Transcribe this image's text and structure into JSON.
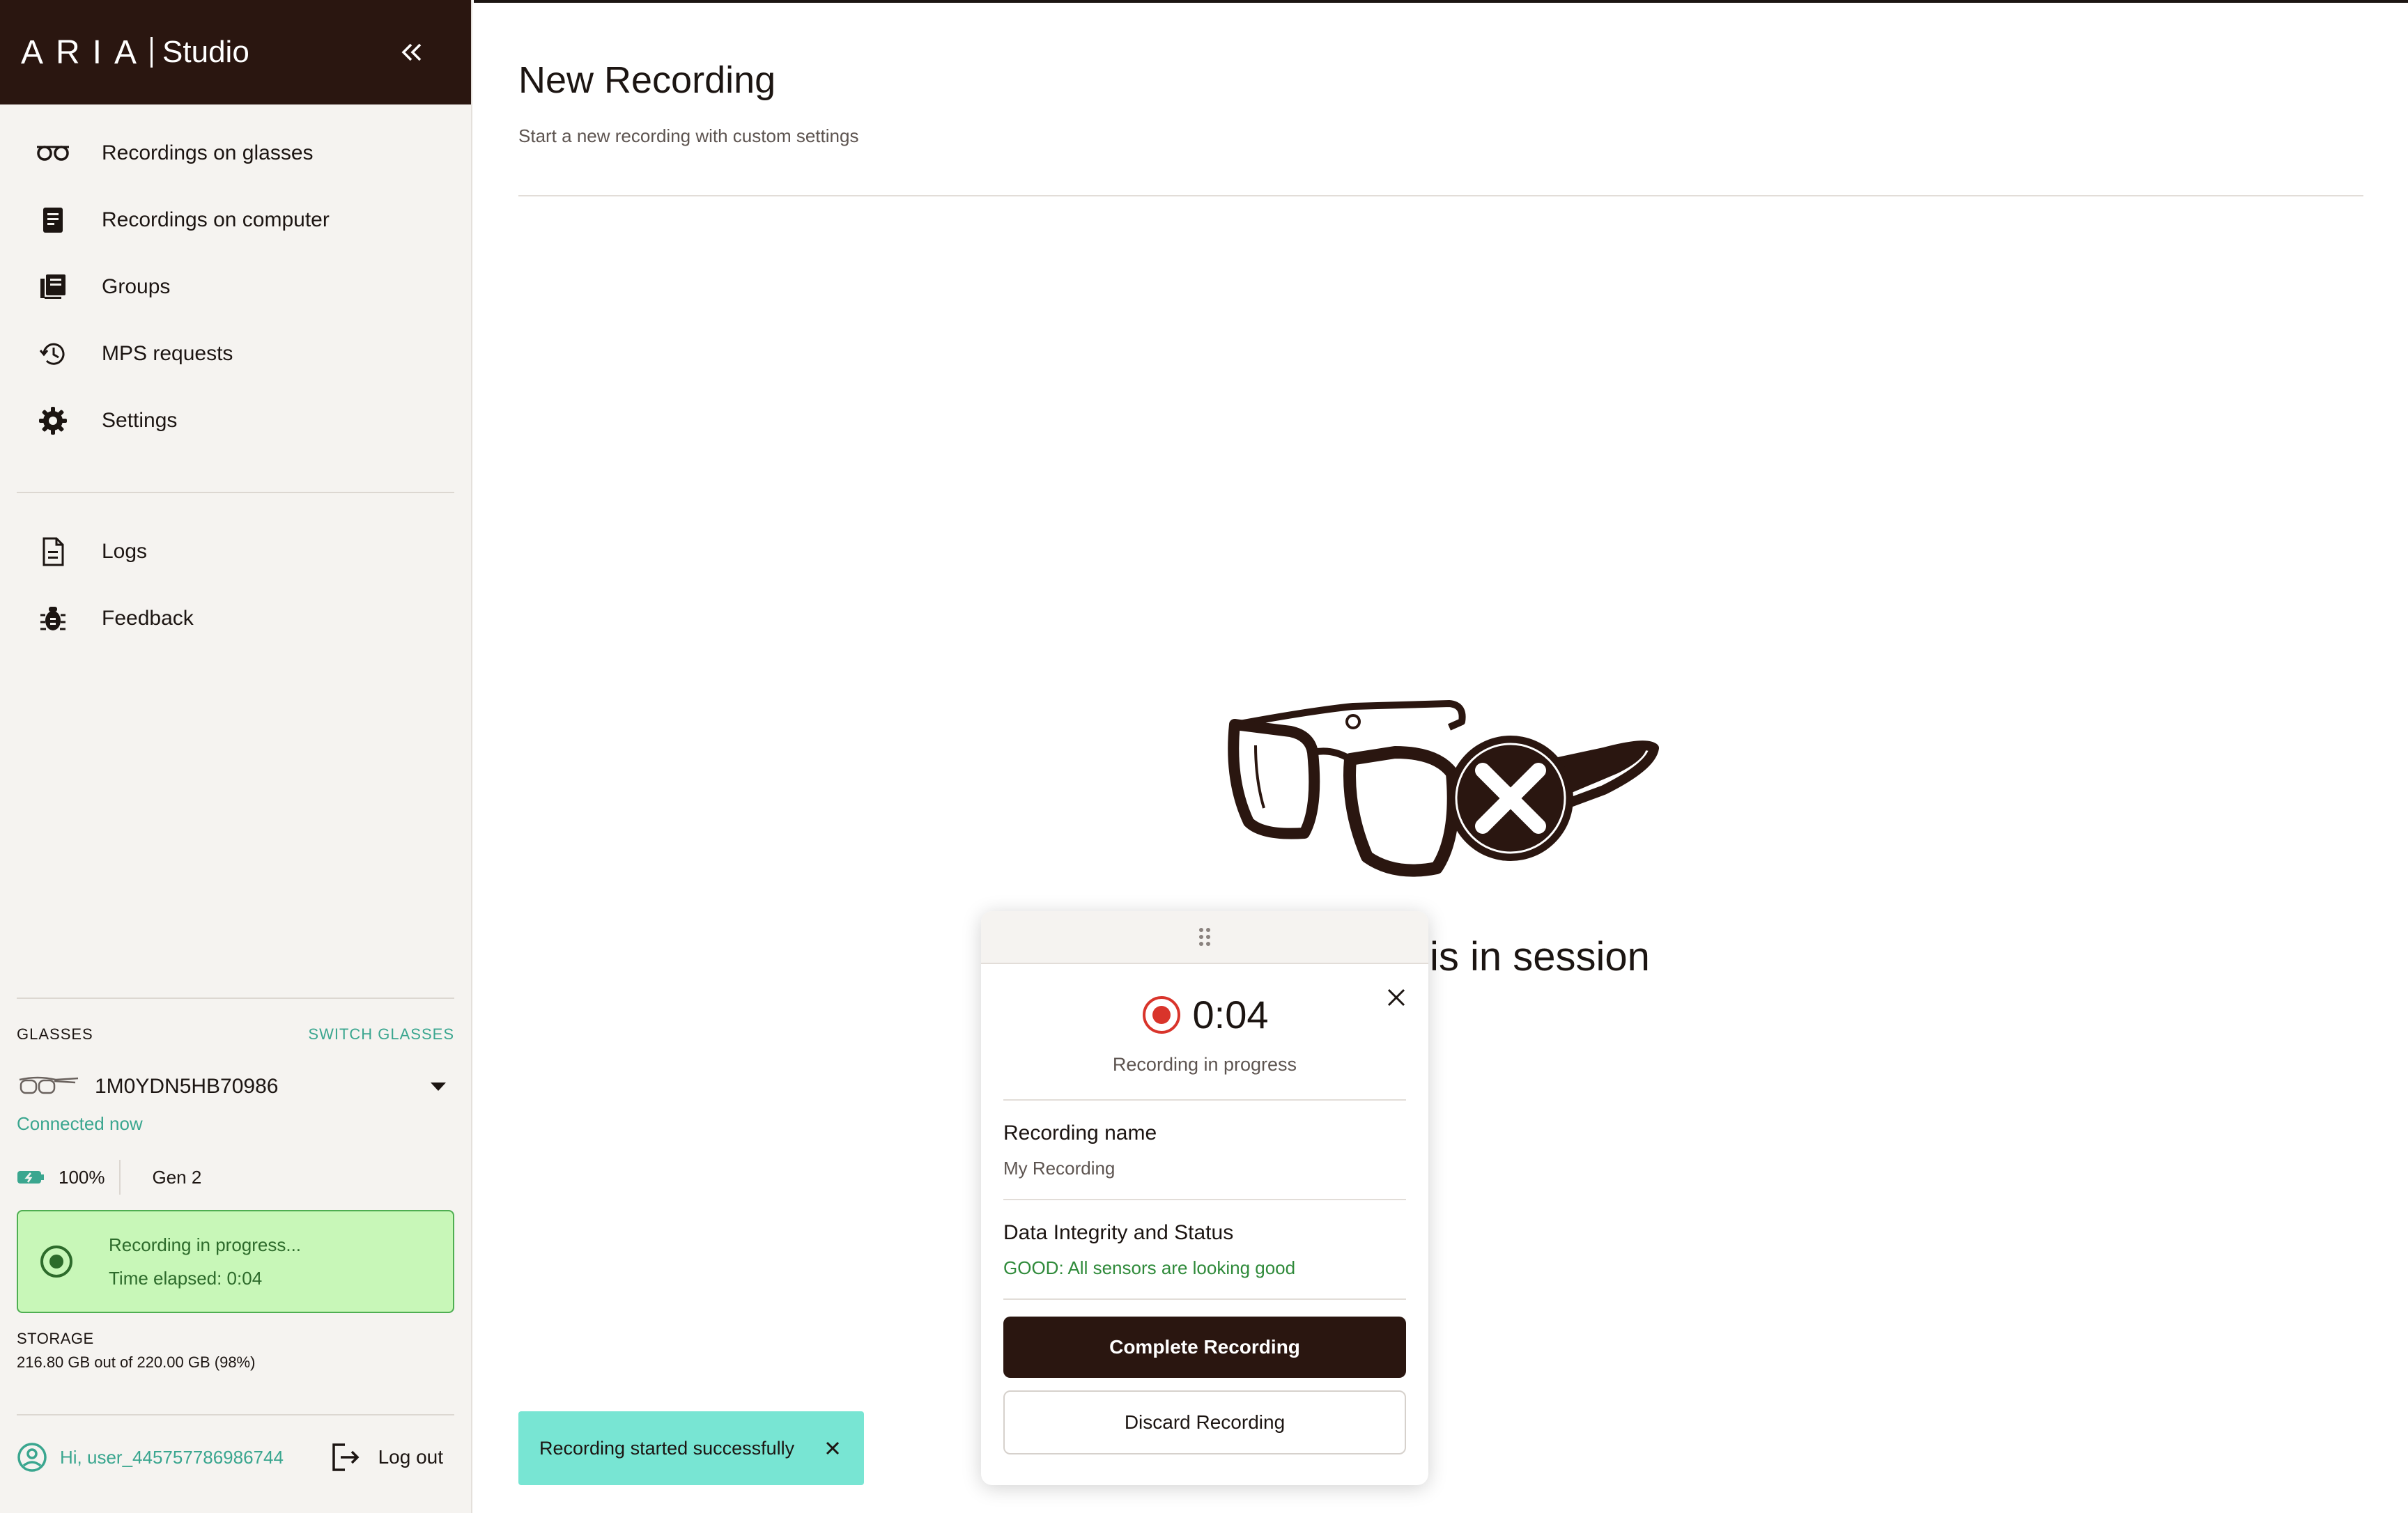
{
  "brand": {
    "name_aria": "ARIA",
    "name_studio": "Studio"
  },
  "sidebar": {
    "collapse_icon": "double-chevron-left-icon",
    "items": [
      {
        "label": "Recordings on glasses",
        "icon": "glasses-icon"
      },
      {
        "label": "Recordings on computer",
        "icon": "document-icon"
      },
      {
        "label": "Groups",
        "icon": "groups-icon"
      },
      {
        "label": "MPS requests",
        "icon": "history-icon"
      },
      {
        "label": "Settings",
        "icon": "gear-icon"
      }
    ],
    "secondary_items": [
      {
        "label": "Logs",
        "icon": "file-icon"
      },
      {
        "label": "Feedback",
        "icon": "bug-icon"
      }
    ]
  },
  "glasses": {
    "title": "GLASSES",
    "switch_label": "SWITCH GLASSES",
    "device_id": "1M0YDN5HB70986",
    "status": "Connected now",
    "battery": "100%",
    "generation": "Gen 2",
    "recording_banner": {
      "line1": "Recording in progress...",
      "line2": "Time elapsed: 0:04"
    },
    "storage_title": "STORAGE",
    "storage_value": "216.80 GB out of 220.00 GB (98%)"
  },
  "user": {
    "greeting": "Hi, user_445757786986744",
    "logout_label": "Log out"
  },
  "main": {
    "title": "New Recording",
    "subtitle": "Start a new recording with custom settings",
    "session_text": "is in session"
  },
  "recording_card": {
    "timer": "0:04",
    "status": "Recording in progress",
    "name_title": "Recording name",
    "name_value": "My Recording",
    "integrity_title": "Data Integrity and Status",
    "integrity_value": "GOOD: All sensors are looking good",
    "complete_label": "Complete Recording",
    "discard_label": "Discard Recording"
  },
  "toast": {
    "message": "Recording started successfully"
  },
  "colors": {
    "brand_dark": "#2a1610",
    "accent_teal": "#3aa68f",
    "recording_red": "#d9342b",
    "banner_green": "#c8f7b8",
    "toast_teal": "#78e5d3"
  }
}
